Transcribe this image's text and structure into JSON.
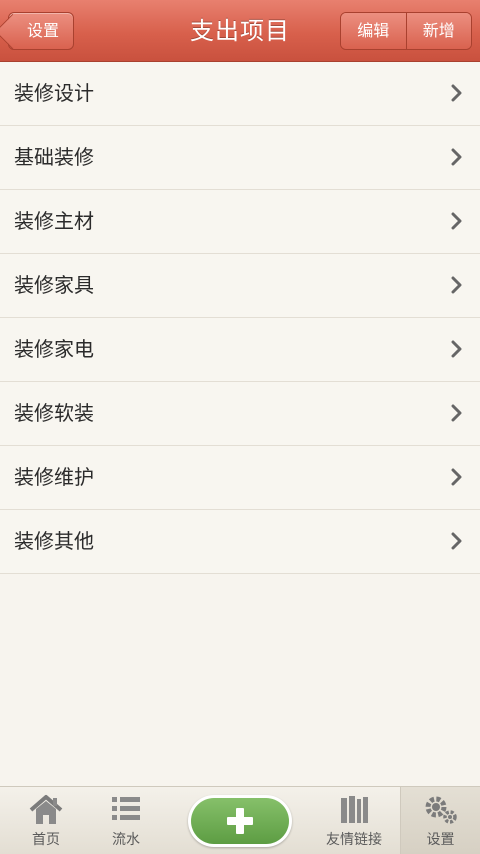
{
  "header": {
    "title": "支出项目",
    "back_label": "设置",
    "edit_label": "编辑",
    "add_label": "新增"
  },
  "items": [
    {
      "label": "装修设计"
    },
    {
      "label": "基础装修"
    },
    {
      "label": "装修主材"
    },
    {
      "label": "装修家具"
    },
    {
      "label": "装修家电"
    },
    {
      "label": "装修软装"
    },
    {
      "label": "装修维护"
    },
    {
      "label": "装修其他"
    }
  ],
  "tabbar": {
    "home": "首页",
    "flow": "流水",
    "links": "友情链接",
    "settings": "设置"
  },
  "colors": {
    "header": "#d8604c",
    "add_button": "#6aa84f",
    "background": "#f7f4ee"
  }
}
